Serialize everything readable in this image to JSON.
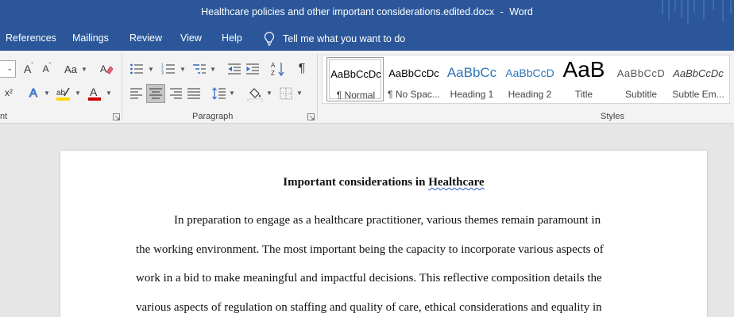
{
  "window": {
    "document_name": "Healthcare policies and other important considerations.edited.docx",
    "separator": "-",
    "app_name": "Word"
  },
  "menu": {
    "tabs": [
      {
        "label": "References"
      },
      {
        "label": "Mailings"
      },
      {
        "label": "Review"
      },
      {
        "label": "View"
      },
      {
        "label": "Help"
      }
    ],
    "tell_me": "Tell me what you want to do"
  },
  "ribbon": {
    "font_group_label": "nt",
    "paragraph_group_label": "Paragraph",
    "styles_group_label": "Styles",
    "font_buttons": {
      "grow": "A",
      "shrink": "A",
      "change_case": "Aa",
      "superscript": "x²",
      "text_effects": "A",
      "font_color": "A"
    },
    "font_color_hex": "#d00000",
    "highlight_hex": "#ffd800",
    "styles": [
      {
        "preview": "AaBbCcDc",
        "name": "¶ Normal",
        "color": "#000000",
        "selected": true
      },
      {
        "preview": "AaBbCcDc",
        "name": "¶ No Spac...",
        "color": "#000000"
      },
      {
        "preview": "AaBbCc",
        "name": "Heading 1",
        "color": "#2e74b5"
      },
      {
        "preview": "AaBbCcD",
        "name": "Heading 2",
        "color": "#2e74b5"
      },
      {
        "preview": "AaB",
        "name": "Title",
        "color": "#000000"
      },
      {
        "preview": "AaBbCcD",
        "name": "Subtitle",
        "color": "#595959"
      },
      {
        "preview": "AaBbCcDc",
        "name": "Subtle Em...",
        "color": "#404040"
      }
    ]
  },
  "document": {
    "title_plain": "Important considerations in",
    "title_flagged": "Healthcare",
    "paragraph_lines": [
      "In preparation to engage as a healthcare practitioner, various themes remain paramount in",
      "the working environment. The most important being the capacity to incorporate various aspects of",
      "work in a bid to make meaningful and impactful decisions. This reflective composition details the",
      "various aspects of regulation on staffing and quality of care, ethical considerations and equality in"
    ]
  }
}
